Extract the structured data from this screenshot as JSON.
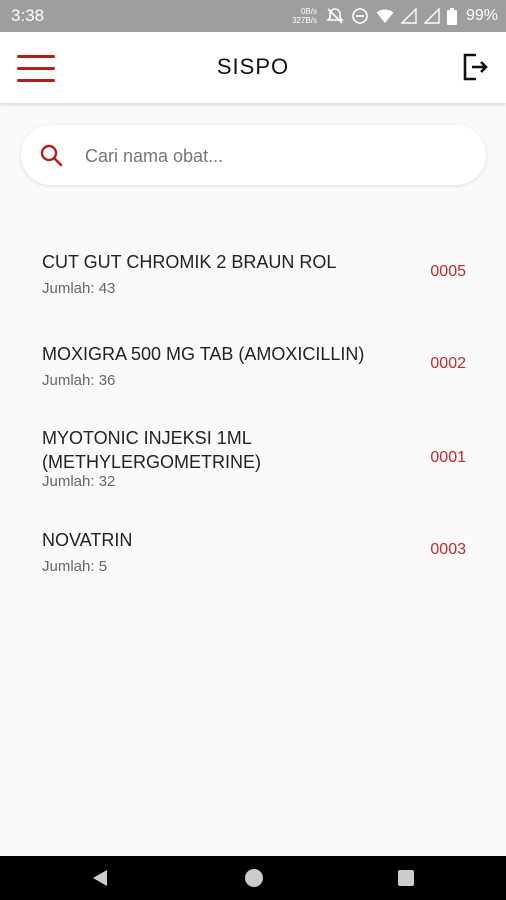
{
  "status_bar": {
    "time": "3:38",
    "net_up": "0B/s",
    "net_down": "327B/s",
    "battery": "99%"
  },
  "app_bar": {
    "title": "SISPO"
  },
  "search": {
    "placeholder": "Cari nama obat..."
  },
  "colors": {
    "accent": "#b71c1c",
    "code": "#c62828"
  },
  "items": [
    {
      "name": "CUT GUT CHROMIK 2 BRAUN ROL",
      "qty": "Jumlah: 43",
      "code": "0005"
    },
    {
      "name": "MOXIGRA 500 MG TAB (AMOXICILLIN)",
      "qty": "Jumlah: 36",
      "code": "0002"
    },
    {
      "name": "MYOTONIC INJEKSI 1ML (METHYLERGOMETRINE)",
      "qty": "Jumlah: 32",
      "code": "0001"
    },
    {
      "name": "NOVATRIN",
      "qty": "Jumlah: 5",
      "code": "0003"
    }
  ]
}
